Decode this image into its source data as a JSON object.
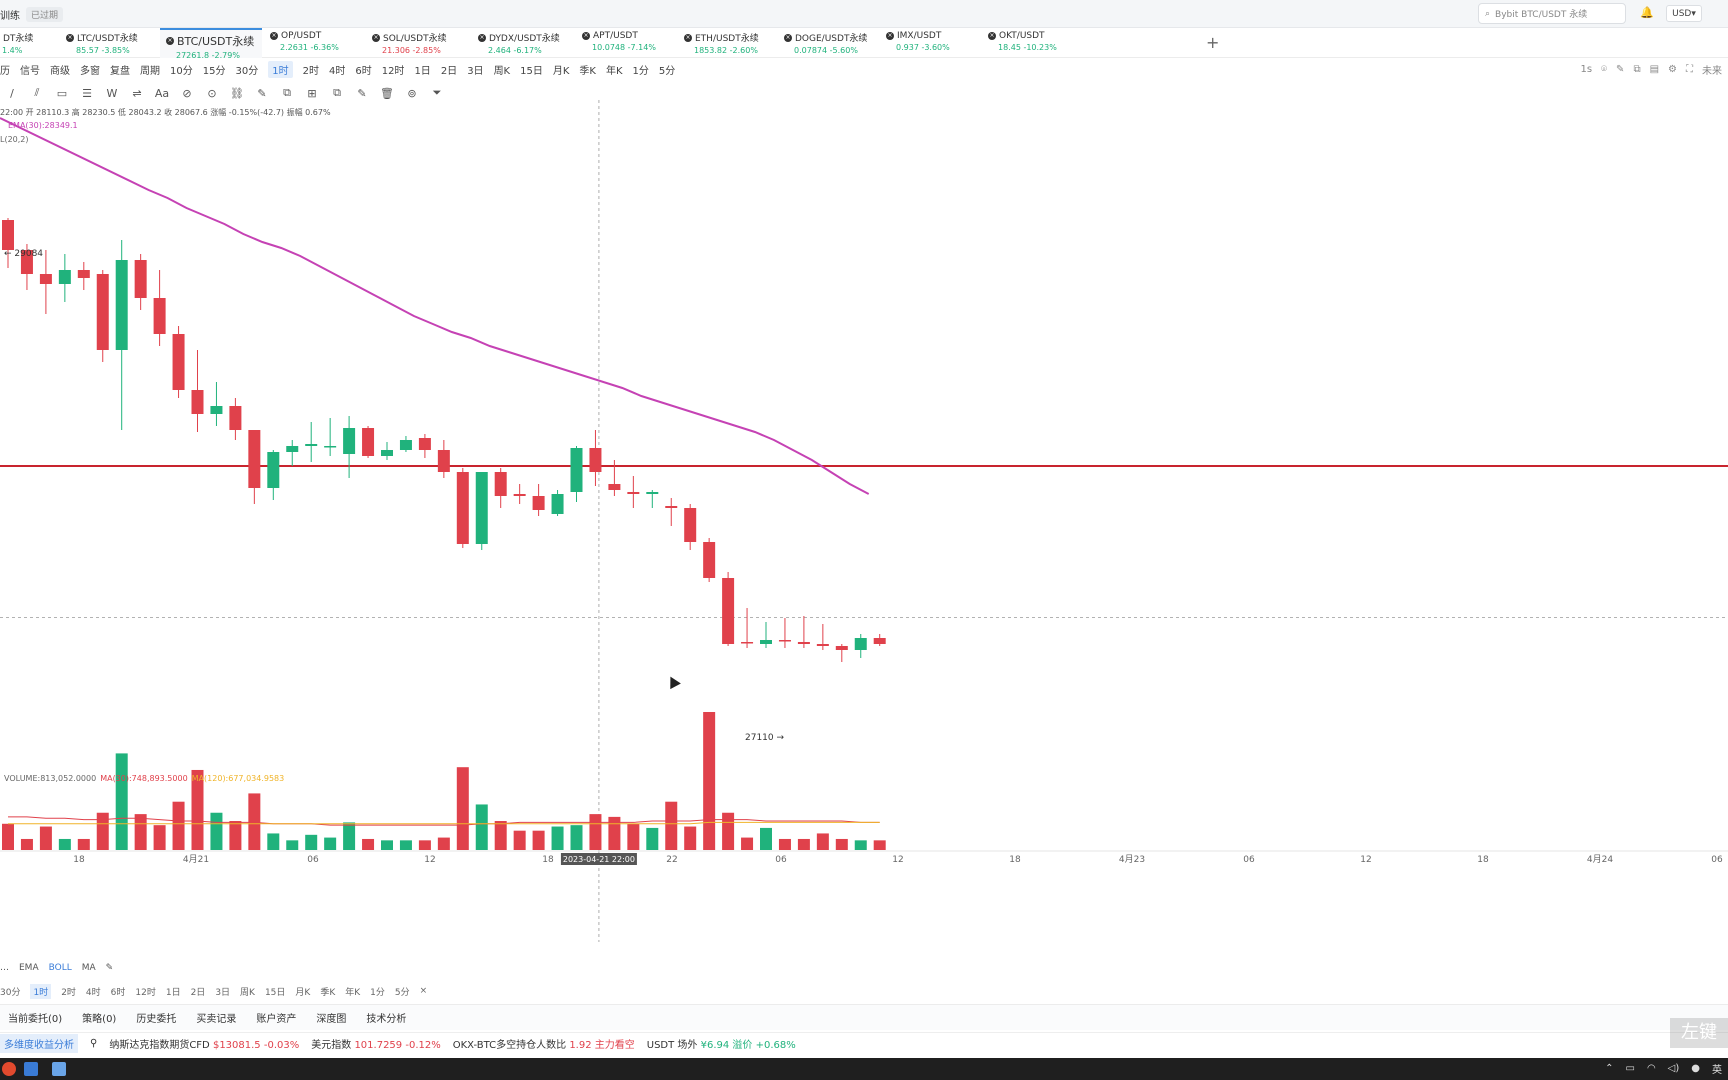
{
  "topbar": {
    "left_text": "训练",
    "status_badge": "已过期",
    "search_placeholder": "Bybit BTC/USDT 永续",
    "currency": "USD"
  },
  "tabs": [
    {
      "name": "DT永续",
      "price": "1.4%",
      "dir": "pos"
    },
    {
      "name": "LTC/USDT永续",
      "price": "85.57 -3.85%",
      "dir": "pos"
    },
    {
      "name": "BTC/USDT永续",
      "price": "27261.8 -2.79%",
      "dir": "pos",
      "active": true
    },
    {
      "name": "OP/USDT",
      "price": "2.2631 -6.36%",
      "dir": "pos"
    },
    {
      "name": "SOL/USDT永续",
      "price": "21.306 -2.85%",
      "dir": "neg"
    },
    {
      "name": "DYDX/USDT永续",
      "price": "2.464 -6.17%",
      "dir": "pos"
    },
    {
      "name": "APT/USDT",
      "price": "10.0748 -7.14%",
      "dir": "pos"
    },
    {
      "name": "ETH/USDT永续",
      "price": "1853.82 -2.60%",
      "dir": "pos"
    },
    {
      "name": "DOGE/USDT永续",
      "price": "0.07874 -5.60%",
      "dir": "pos"
    },
    {
      "name": "IMX/USDT",
      "price": "0.937 -3.60%",
      "dir": "pos"
    },
    {
      "name": "OKT/USDT",
      "price": "18.45 -10.23%",
      "dir": "pos"
    }
  ],
  "toolbar1": {
    "items": [
      "历",
      "信号",
      "商级",
      "多窗",
      "复盘",
      "周期",
      "10分",
      "15分",
      "30分",
      "1时",
      "2时",
      "4时",
      "6时",
      "12时",
      "1日",
      "2日",
      "3日",
      "周K",
      "15日",
      "月K",
      "季K",
      "年K",
      "1分",
      "5分"
    ],
    "selected": "1时",
    "right_label": "1s",
    "right_end": "未来"
  },
  "toolbar2": {
    "icons": [
      "/",
      "⫽",
      "▭",
      "☰",
      "W",
      "⇌",
      "Aa",
      "⊘",
      "⊙",
      "⛓",
      "✎",
      "⧉",
      "⊞",
      "⧉",
      "✎",
      "🗑",
      "⊚",
      "⏷"
    ]
  },
  "ohlc_text": "22:00  开 28110.3  高 28230.5  低 28043.2  收 28067.6  涨幅 -0.15%(-42.7)  振幅 0.67%",
  "ema_label": "EMA(30):28349.1",
  "boll_label": "L(20,2)",
  "annotations": {
    "high": "← 29084",
    "low": "27110 →",
    "crosshair_time": "2023-04-21 22:00"
  },
  "volume_labels": {
    "volume": "VOLUME:813,052.0000",
    "ma30": "MA(30):748,893.5000",
    "ma120": "MA(120):677,034.9583"
  },
  "x_axis_labels": [
    "18",
    "4月21",
    "06",
    "12",
    "18",
    "22",
    "06",
    "12",
    "18",
    "4月23",
    "06",
    "12",
    "18",
    "4月24",
    "06"
  ],
  "indicator_bar": [
    "…",
    "EMA",
    "BOLL",
    "MA"
  ],
  "timeframes": [
    "30分",
    "1时",
    "2时",
    "4时",
    "6时",
    "12时",
    "1日",
    "2日",
    "3日",
    "周K",
    "15日",
    "月K",
    "季K",
    "年K",
    "1分",
    "5分"
  ],
  "tf_selected": "1时",
  "bottom_tabs": [
    "当前委托(0)",
    "策略(0)",
    "历史委托",
    "买卖记录",
    "账户资产",
    "深度图",
    "技术分析"
  ],
  "ticker": {
    "highlight": "多维度收益分析",
    "items": [
      {
        "label": "纳斯达克指数期货CFD",
        "value": "$13081.5",
        "change": "-0.03%"
      },
      {
        "label": "美元指数",
        "value": "101.7259",
        "change": "-0.12%"
      },
      {
        "label": "OKX-BTC多空持仓人数比",
        "value": "1.92",
        "change": "主力看空"
      },
      {
        "label": "USDT 场外",
        "value": "¥6.94",
        "change": "溢价 +0.68%"
      }
    ]
  },
  "watermark": "左键",
  "taskbar": {
    "ime": "英"
  },
  "colors": {
    "up": "#20b27c",
    "down": "#e0414b",
    "ema": "#c542b4",
    "accent": "#3c8dde",
    "support": "#c8242e",
    "ma30": "#e0414b",
    "ma120": "#f0b429"
  },
  "chart_data": {
    "type": "candlestick",
    "interval": "1时",
    "ylim": [
      26800,
      29550
    ],
    "support_line": 28020,
    "current_price": 27262,
    "candles": [
      [
        29250,
        29260,
        29010,
        29100
      ],
      [
        29100,
        29130,
        28900,
        28980
      ],
      [
        28980,
        29100,
        28780,
        28930
      ],
      [
        28930,
        29080,
        28840,
        29000
      ],
      [
        29000,
        29040,
        28900,
        28960
      ],
      [
        28980,
        29000,
        28540,
        28600
      ],
      [
        28600,
        29150,
        28200,
        29050
      ],
      [
        29050,
        29080,
        28800,
        28860
      ],
      [
        28860,
        29000,
        28620,
        28680
      ],
      [
        28680,
        28720,
        28360,
        28400
      ],
      [
        28400,
        28600,
        28190,
        28280
      ],
      [
        28280,
        28440,
        28220,
        28320
      ],
      [
        28320,
        28360,
        28150,
        28200
      ],
      [
        28200,
        28200,
        27830,
        27910
      ],
      [
        27910,
        28100,
        27850,
        28090
      ],
      [
        28090,
        28150,
        28020,
        28120
      ],
      [
        28120,
        28240,
        28040,
        28130
      ],
      [
        28120,
        28260,
        28070,
        28120
      ],
      [
        28080,
        28270,
        27960,
        28210
      ],
      [
        28210,
        28220,
        28060,
        28070
      ],
      [
        28070,
        28140,
        28050,
        28100
      ],
      [
        28100,
        28170,
        28090,
        28150
      ],
      [
        28160,
        28180,
        28060,
        28100
      ],
      [
        28100,
        28150,
        27960,
        27990
      ],
      [
        27990,
        28010,
        27610,
        27630
      ],
      [
        27630,
        27990,
        27600,
        27990
      ],
      [
        27990,
        28010,
        27810,
        27870
      ],
      [
        27880,
        27930,
        27830,
        27870
      ],
      [
        27870,
        27930,
        27770,
        27800
      ],
      [
        27780,
        27900,
        27770,
        27880
      ],
      [
        27890,
        28120,
        27840,
        28110
      ],
      [
        28110,
        28200,
        27920,
        27990
      ],
      [
        27930,
        28050,
        27870,
        27900
      ],
      [
        27890,
        27970,
        27810,
        27880
      ],
      [
        27880,
        27900,
        27810,
        27890
      ],
      [
        27820,
        27860,
        27720,
        27810
      ],
      [
        27810,
        27830,
        27600,
        27640
      ],
      [
        27640,
        27660,
        27440,
        27460
      ],
      [
        27460,
        27490,
        27120,
        27130
      ],
      [
        27140,
        27310,
        27110,
        27135
      ],
      [
        27130,
        27240,
        27110,
        27150
      ],
      [
        27150,
        27260,
        27110,
        27145
      ],
      [
        27140,
        27270,
        27110,
        27130
      ],
      [
        27130,
        27230,
        27100,
        27120
      ],
      [
        27120,
        27130,
        27040,
        27100
      ],
      [
        27100,
        27180,
        27060,
        27160
      ],
      [
        27160,
        27180,
        27120,
        27130
      ]
    ],
    "ema30": [
      29400,
      29360,
      29310,
      29270,
      29230,
      29180,
      29140,
      29110,
      29070,
      29020,
      28970,
      28920,
      28870,
      28820,
      28770,
      28730,
      28690,
      28660,
      28620,
      28590,
      28560,
      28530,
      28500,
      28470,
      28440,
      28410,
      28370,
      28340,
      28310,
      28280,
      28250,
      28220,
      28190,
      28150,
      28100,
      28050,
      27990,
      27930,
      27880
    ],
    "volumes": [
      0.19,
      0.08,
      0.17,
      0.08,
      0.08,
      0.27,
      0.7,
      0.26,
      0.18,
      0.35,
      0.58,
      0.27,
      0.21,
      0.41,
      0.12,
      0.07,
      0.11,
      0.09,
      0.2,
      0.08,
      0.07,
      0.07,
      0.07,
      0.09,
      0.6,
      0.33,
      0.21,
      0.14,
      0.14,
      0.17,
      0.18,
      0.26,
      0.24,
      0.19,
      0.16,
      0.35,
      0.17,
      1.0,
      0.27,
      0.09,
      0.16,
      0.08,
      0.08,
      0.12,
      0.08,
      0.07,
      0.07
    ],
    "ma30_vol": [
      0.24,
      0.24,
      0.23,
      0.23,
      0.22,
      0.22,
      0.23,
      0.23,
      0.22,
      0.21,
      0.21,
      0.2,
      0.2,
      0.2,
      0.19,
      0.19,
      0.19,
      0.18,
      0.18,
      0.18,
      0.18,
      0.18,
      0.18,
      0.18,
      0.18,
      0.19,
      0.19,
      0.2,
      0.2,
      0.2,
      0.2,
      0.2,
      0.2,
      0.2,
      0.21,
      0.21,
      0.21,
      0.22,
      0.22,
      0.22,
      0.21,
      0.21,
      0.21,
      0.21,
      0.21,
      0.2,
      0.2
    ],
    "ma120_vol": [
      0.19,
      0.19,
      0.19,
      0.19,
      0.19,
      0.19,
      0.19,
      0.19,
      0.19,
      0.19,
      0.19,
      0.19,
      0.19,
      0.19,
      0.19,
      0.19,
      0.19,
      0.19,
      0.19,
      0.19,
      0.19,
      0.19,
      0.19,
      0.19,
      0.19,
      0.19,
      0.19,
      0.19,
      0.19,
      0.19,
      0.19,
      0.19,
      0.19,
      0.19,
      0.19,
      0.19,
      0.19,
      0.2,
      0.2,
      0.2,
      0.2,
      0.2,
      0.2,
      0.2,
      0.2,
      0.2,
      0.2
    ]
  }
}
